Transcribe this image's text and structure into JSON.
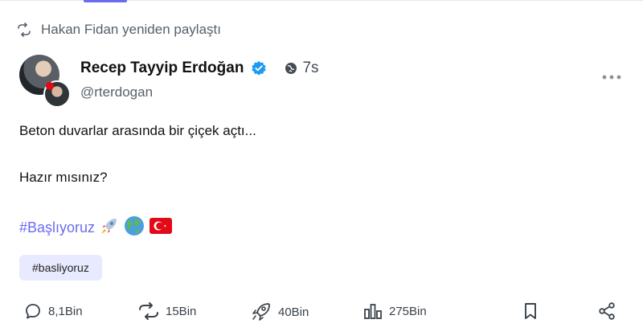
{
  "repost": {
    "text": "Hakan Fidan yeniden paylaştı",
    "icon": "repost-icon"
  },
  "author": {
    "name": "Recep Tayyip Erdoğan",
    "handle": "@rterdogan",
    "verified": true,
    "time": "7s"
  },
  "post": {
    "line1": "Beton duvarlar arasında bir çiçek açtı...",
    "line2": "Hazır mısınız?",
    "hashtag": "#Başlıyoruz",
    "emojis": [
      "rocket-emoji",
      "globe-emoji",
      "turkey-flag-emoji"
    ]
  },
  "tag_chip": "#basliyoruz",
  "actions": {
    "replies": "8,1Bin",
    "reposts": "15Bin",
    "boosts": "40Bin",
    "views": "275Bin"
  },
  "colors": {
    "accent": "#6b6bf0",
    "chip_bg": "#e8eaff",
    "verified": "#1d9bf0",
    "flag": "#e30a17"
  }
}
